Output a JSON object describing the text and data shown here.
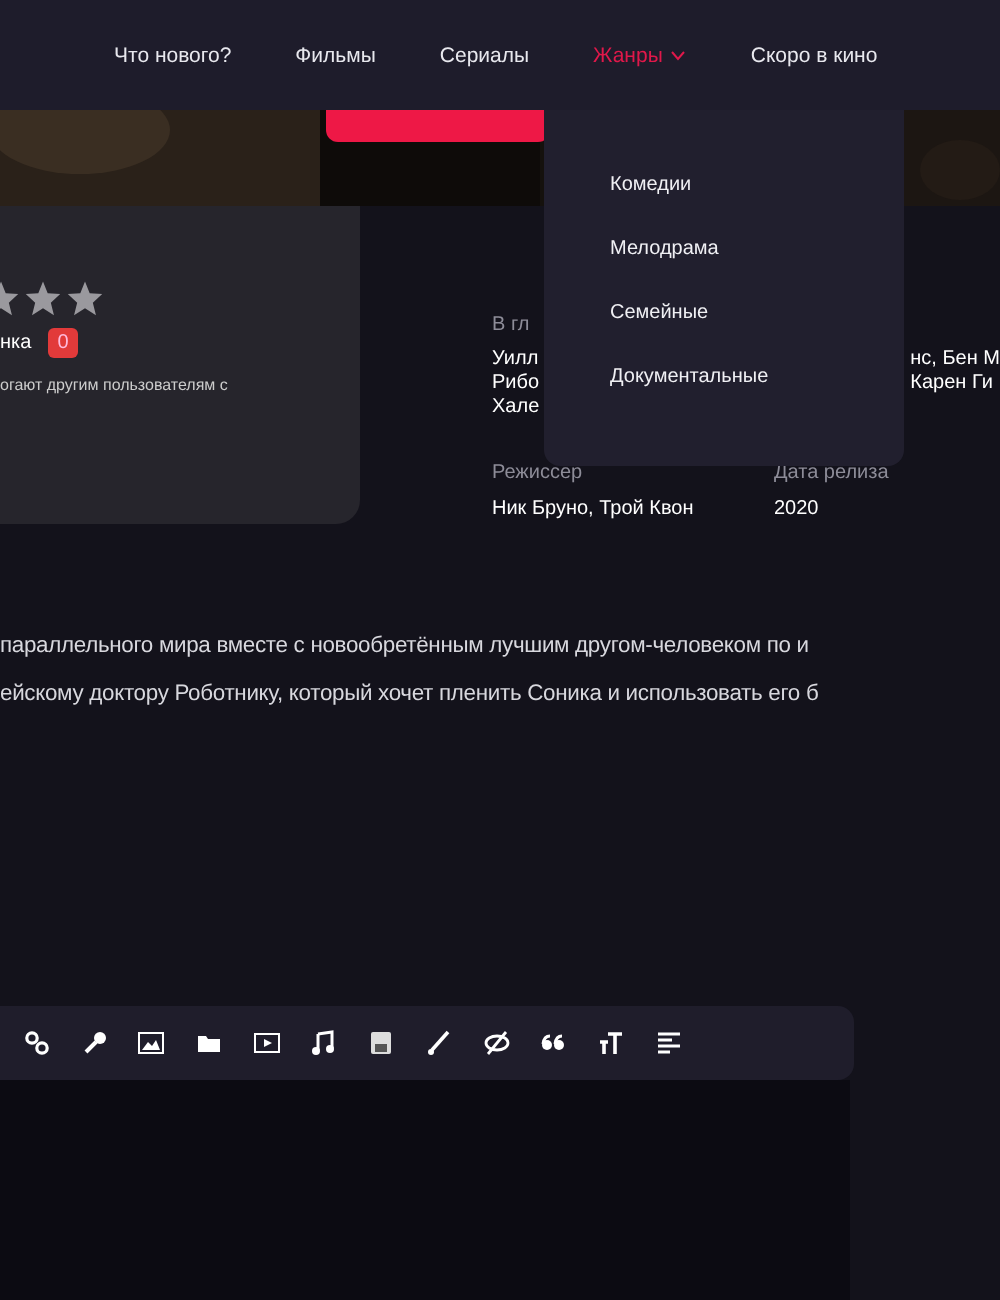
{
  "nav": {
    "items": [
      {
        "label": "Что нового?",
        "selected": false,
        "expanded": false
      },
      {
        "label": "Фильмы",
        "selected": false,
        "expanded": false
      },
      {
        "label": "Сериалы",
        "selected": false,
        "expanded": false
      },
      {
        "label": "Жанры",
        "selected": true,
        "expanded": true
      },
      {
        "label": "Скоро в кино",
        "selected": false,
        "expanded": false
      }
    ]
  },
  "genre_menu": {
    "items": [
      "Комедии",
      "Мелодрама",
      "Семейные",
      "Документальные"
    ]
  },
  "rating_card": {
    "label": "нка",
    "count": "0",
    "note": "огают другим пользователям с"
  },
  "info": {
    "cast_label": "В гл",
    "cast_left": [
      "Уилл",
      "Рибо",
      "Хале"
    ],
    "cast_right": [
      "нс, Бен М",
      "Карен Ги"
    ],
    "director_label": "Режиссер",
    "director": "Ник Бруно, Трой Квон",
    "release_label": "Дата релиза",
    "release": "2020"
  },
  "description": [
    "параллельного мира вместе с новообретённым лучшим другом-человеком по и",
    "ейскому доктору Роботнику, который хочет пленить Соника и использовать его б"
  ]
}
